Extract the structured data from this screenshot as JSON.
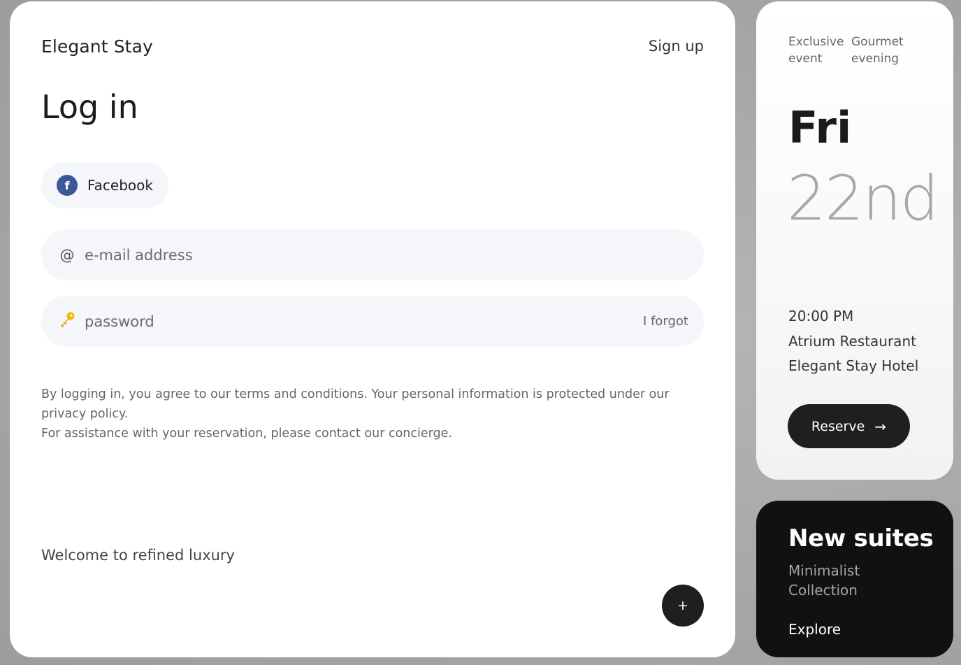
{
  "brand": "Elegant Stay",
  "header": {
    "signup_label": "Sign up"
  },
  "login": {
    "title": "Log in",
    "facebook_label": "Facebook",
    "facebook_icon": "facebook-icon",
    "email": {
      "icon": "at-icon",
      "icon_glyph": "@",
      "placeholder": "e-mail address",
      "value": ""
    },
    "password": {
      "icon": "key-icon",
      "icon_glyph": "🔑",
      "placeholder": "password",
      "value": "",
      "forgot_label": "I forgot"
    },
    "terms_line1": "By logging in, you agree to our terms and conditions. Your personal information is protected under our privacy policy.",
    "terms_line2": "For assistance with your reservation, please contact our concierge.",
    "welcome": "Welcome to refined luxury",
    "fab_label": "+"
  },
  "event": {
    "tags": [
      "Exclusive event",
      "Gourmet evening"
    ],
    "day": "Fri",
    "date": "22nd",
    "time": "20:00 PM",
    "venue": "Atrium Restaurant",
    "hotel": "Elegant Stay Hotel",
    "reserve_label": "Reserve",
    "reserve_arrow": "→"
  },
  "suites": {
    "title": "New suites",
    "subtitle": "Minimalist Collection",
    "explore_label": "Explore"
  },
  "colors": {
    "background": "#a5a5a5",
    "card": "#ffffff",
    "field": "#f5f6fa",
    "dark": "#1f1f1f",
    "facebook": "#3b5998",
    "key": "#f2b705"
  }
}
